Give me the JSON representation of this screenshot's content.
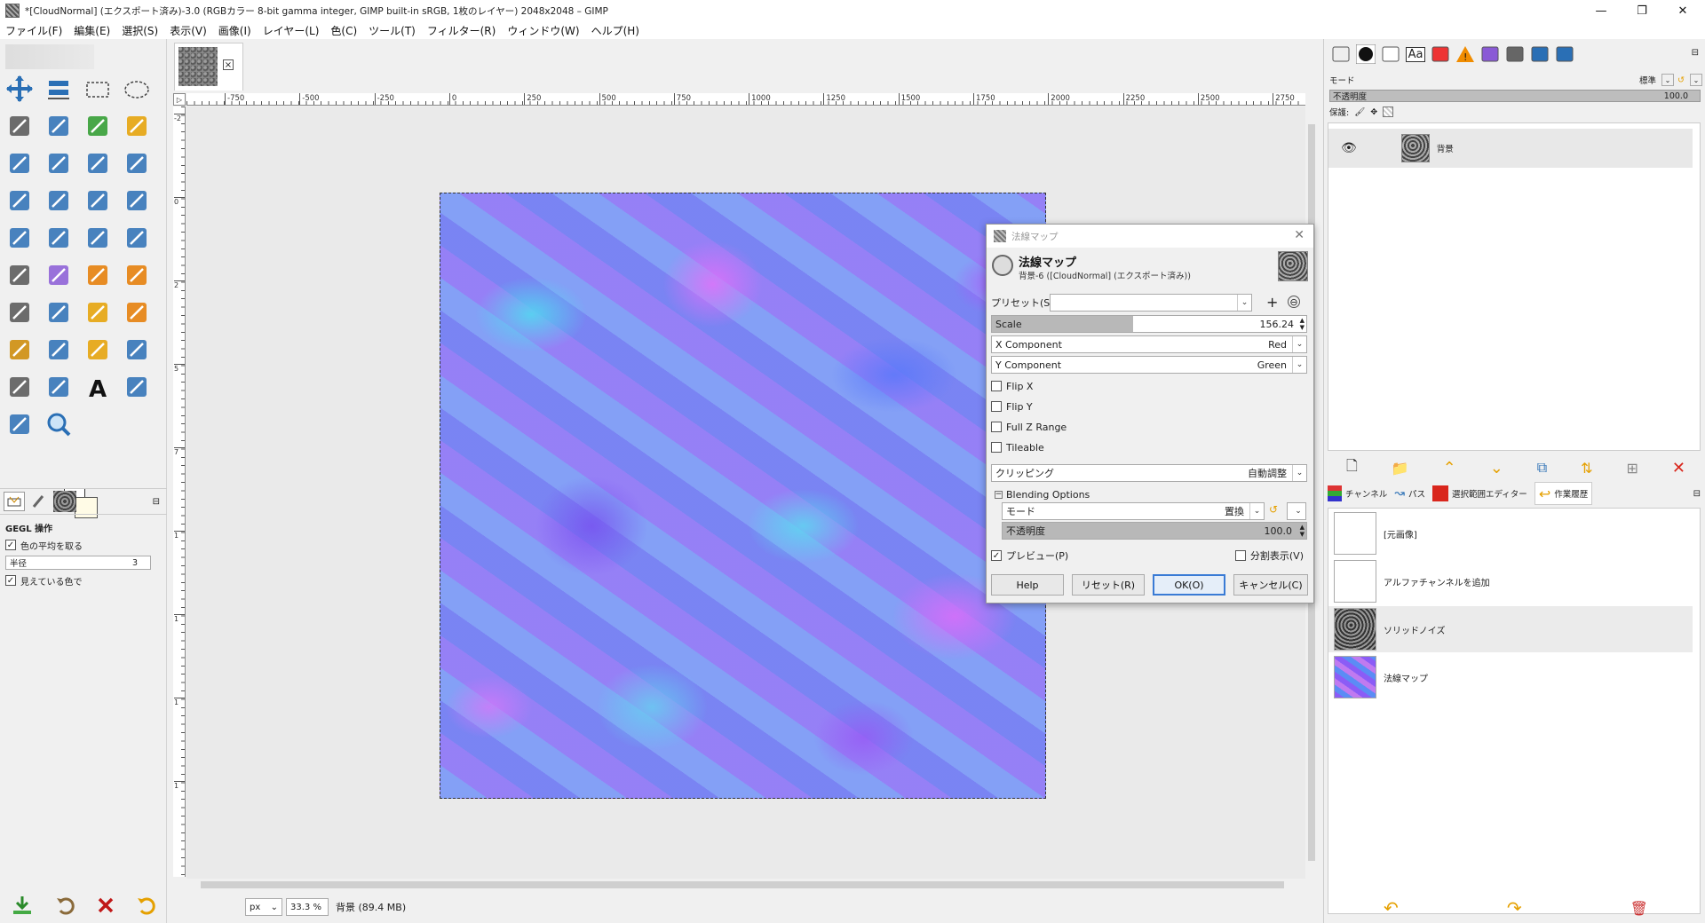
{
  "window": {
    "title": "*[CloudNormal] (エクスポート済み)-3.0 (RGBカラー 8-bit gamma integer, GIMP built-in sRGB, 1枚のレイヤー) 2048x2048 – GIMP",
    "minimize": "—",
    "maximize": "❐",
    "close": "✕"
  },
  "menu": [
    "ファイル(F)",
    "編集(E)",
    "選択(S)",
    "表示(V)",
    "画像(I)",
    "レイヤー(L)",
    "色(C)",
    "ツール(T)",
    "フィルター(R)",
    "ウィンドウ(W)",
    "ヘルプ(H)"
  ],
  "toolbox": {
    "tools": [
      "move-tool",
      "align-tool",
      "rect-select",
      "ellipse-select",
      "free-select",
      "scissors-select",
      "foreground-select",
      "fuzzy-select",
      "by-color-select",
      "crop-tool",
      "unified-transform",
      "warp-transform",
      "handle-transform",
      "perspective-tool",
      "flip-tool",
      "3d-transform",
      "cage-transform",
      "n-point-deform",
      "wave-tool",
      "gradient-tool",
      "bucket-fill",
      "blend-tool",
      "paintbrush",
      "pencil",
      "mypaint-brush",
      "ink-tool",
      "smudge-tool",
      "eraser",
      "clone-tool",
      "heal-tool",
      "perspective-clone",
      "blur-tool",
      "dodge-tool",
      "path-tool",
      "text-tool",
      "color-picker",
      "measure-tool",
      "zoom-tool"
    ],
    "options_title": "GEGL 操作",
    "opt_average": "色の平均を取る",
    "opt_radius_label": "半径",
    "opt_radius_value": "3",
    "opt_visible": "見えている色で"
  },
  "ruler": {
    "ticks": [
      "-750",
      "-500",
      "-250",
      "0",
      "250",
      "500",
      "750",
      "1000",
      "1250",
      "1500",
      "1750",
      "2000",
      "2250",
      "2500",
      "2750"
    ],
    "left_ticks": [
      "-2",
      "0",
      "2",
      "5",
      "7",
      "1",
      "1",
      "1",
      "1"
    ]
  },
  "statusbar": {
    "unit": "px",
    "zoom": "33.3 %",
    "info": "背景 (89.4 MB)"
  },
  "dialog": {
    "window_title": "法線マップ",
    "heading": "法線マップ",
    "subheading": "背景-6 ([CloudNormal] (エクスポート済み))",
    "preset_label": "プリセット(S):",
    "preset_value": "",
    "scale_label": "Scale",
    "scale_value": "156.24",
    "scale_fraction": 0.45,
    "x_label": "X Component",
    "x_value": "Red",
    "y_label": "Y Component",
    "y_value": "Green",
    "flip_x": "Flip X",
    "flip_y": "Flip Y",
    "full_z": "Full Z Range",
    "tileable": "Tileable",
    "clipping_label": "クリッピング",
    "clipping_value": "自動調整",
    "blending": "Blending Options",
    "mode_label": "モード",
    "mode_value": "置換",
    "opacity_label": "不透明度",
    "opacity_value": "100.0",
    "preview": "プレビュー(P)",
    "split": "分割表示(V)",
    "btn_help": "Help",
    "btn_reset": "リセット(R)",
    "btn_ok": "OK(O)",
    "btn_cancel": "キャンセル(C)"
  },
  "layers": {
    "mode_label": "モード",
    "mode_value": "標準",
    "opacity_label": "不透明度",
    "opacity_value": "100.0",
    "lock_label": "保護:",
    "layer_name": "背景"
  },
  "lower_dock": {
    "tabs": [
      "チャンネル",
      "パス",
      "選択範囲エディター",
      "作業履歴"
    ],
    "history": [
      "[元画像]",
      "アルファチャンネルを追加",
      "ソリッドノイズ",
      "法線マップ"
    ]
  },
  "colors": {
    "accent": "#3a7bd5",
    "delete_red": "#d9261c",
    "history_selected": "#ebebeb"
  }
}
